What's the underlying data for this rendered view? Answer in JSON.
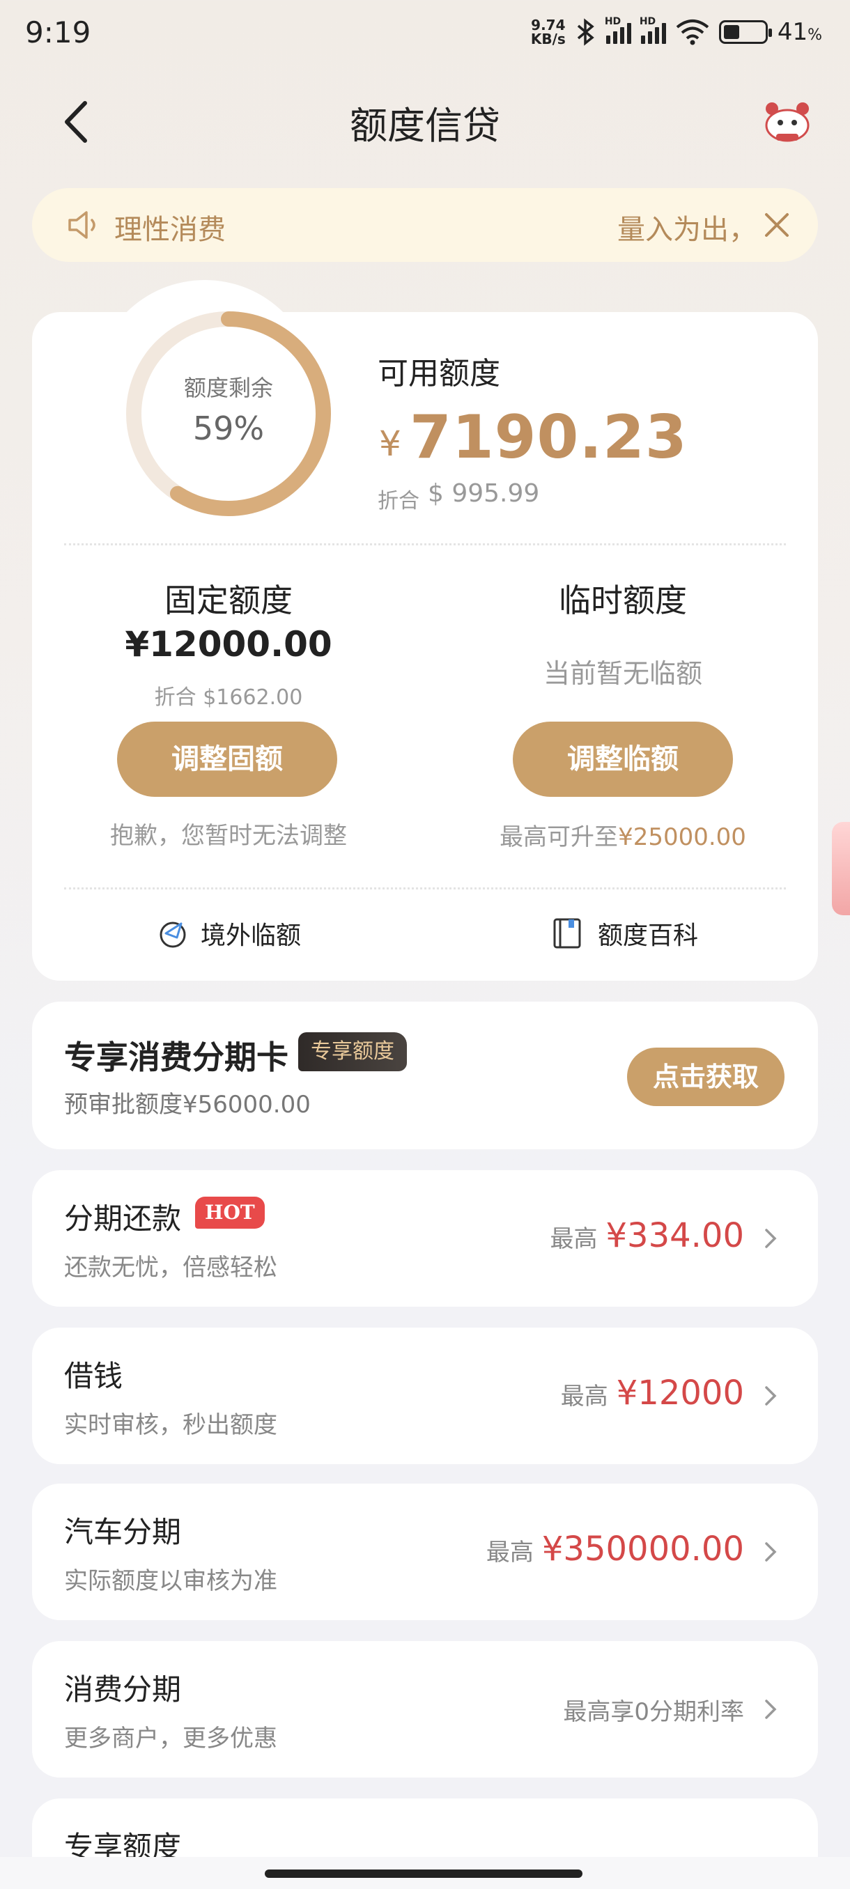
{
  "status_bar": {
    "time": "9:19",
    "net_speed_value": "9.74",
    "net_speed_unit": "KB/s",
    "battery": "41",
    "battery_unit": "%",
    "signal_badge": "HD"
  },
  "header": {
    "title": "额度信贷"
  },
  "notice": {
    "text_left": "理性消费",
    "text_right": "量入为出，"
  },
  "credit": {
    "ring_label": "额度剩余",
    "remaining_percent_text": "59%",
    "remaining_fraction": 0.59,
    "available_label": "可用额度",
    "available_currency": "¥",
    "available_amount": "7190.23",
    "available_converted_label": "折合",
    "available_converted": "$ 995.99",
    "fixed": {
      "title": "固定额度",
      "amount": "¥12000.00",
      "converted": "折合 $1662.00",
      "button_label": "调整固额",
      "note": "抱歉，您暂时无法调整"
    },
    "temporary": {
      "title": "临时额度",
      "status": "当前暂无临额",
      "button_label": "调整临额",
      "note_prefix": "最高可升至",
      "note_amount": "¥25000.00"
    },
    "links": {
      "overseas": "境外临额",
      "wiki": "额度百科"
    }
  },
  "exclusive": {
    "title": "专享消费分期卡",
    "badge": "专享额度",
    "subtitle": "预审批额度¥56000.00",
    "button_label": "点击获取"
  },
  "rows": [
    {
      "title": "分期还款",
      "badge": "HOT",
      "subtitle": "还款无忧，倍感轻松",
      "prefix": "最高",
      "amount": "¥334.00"
    },
    {
      "title": "借钱",
      "subtitle": "实时审核，秒出额度",
      "prefix": "最高",
      "amount": "¥12000"
    },
    {
      "title": "汽车分期",
      "subtitle": "实际额度以审核为准",
      "prefix": "最高",
      "amount": "¥350000.00"
    },
    {
      "title": "消费分期",
      "subtitle": "更多商户，更多优惠",
      "prefix": "最高享0分期利率",
      "amount": ""
    },
    {
      "title": "专享额度"
    }
  ],
  "colors": {
    "accent_gold": "#caa06a",
    "amount_red": "#d44848",
    "ring_track": "#f2e8de"
  }
}
